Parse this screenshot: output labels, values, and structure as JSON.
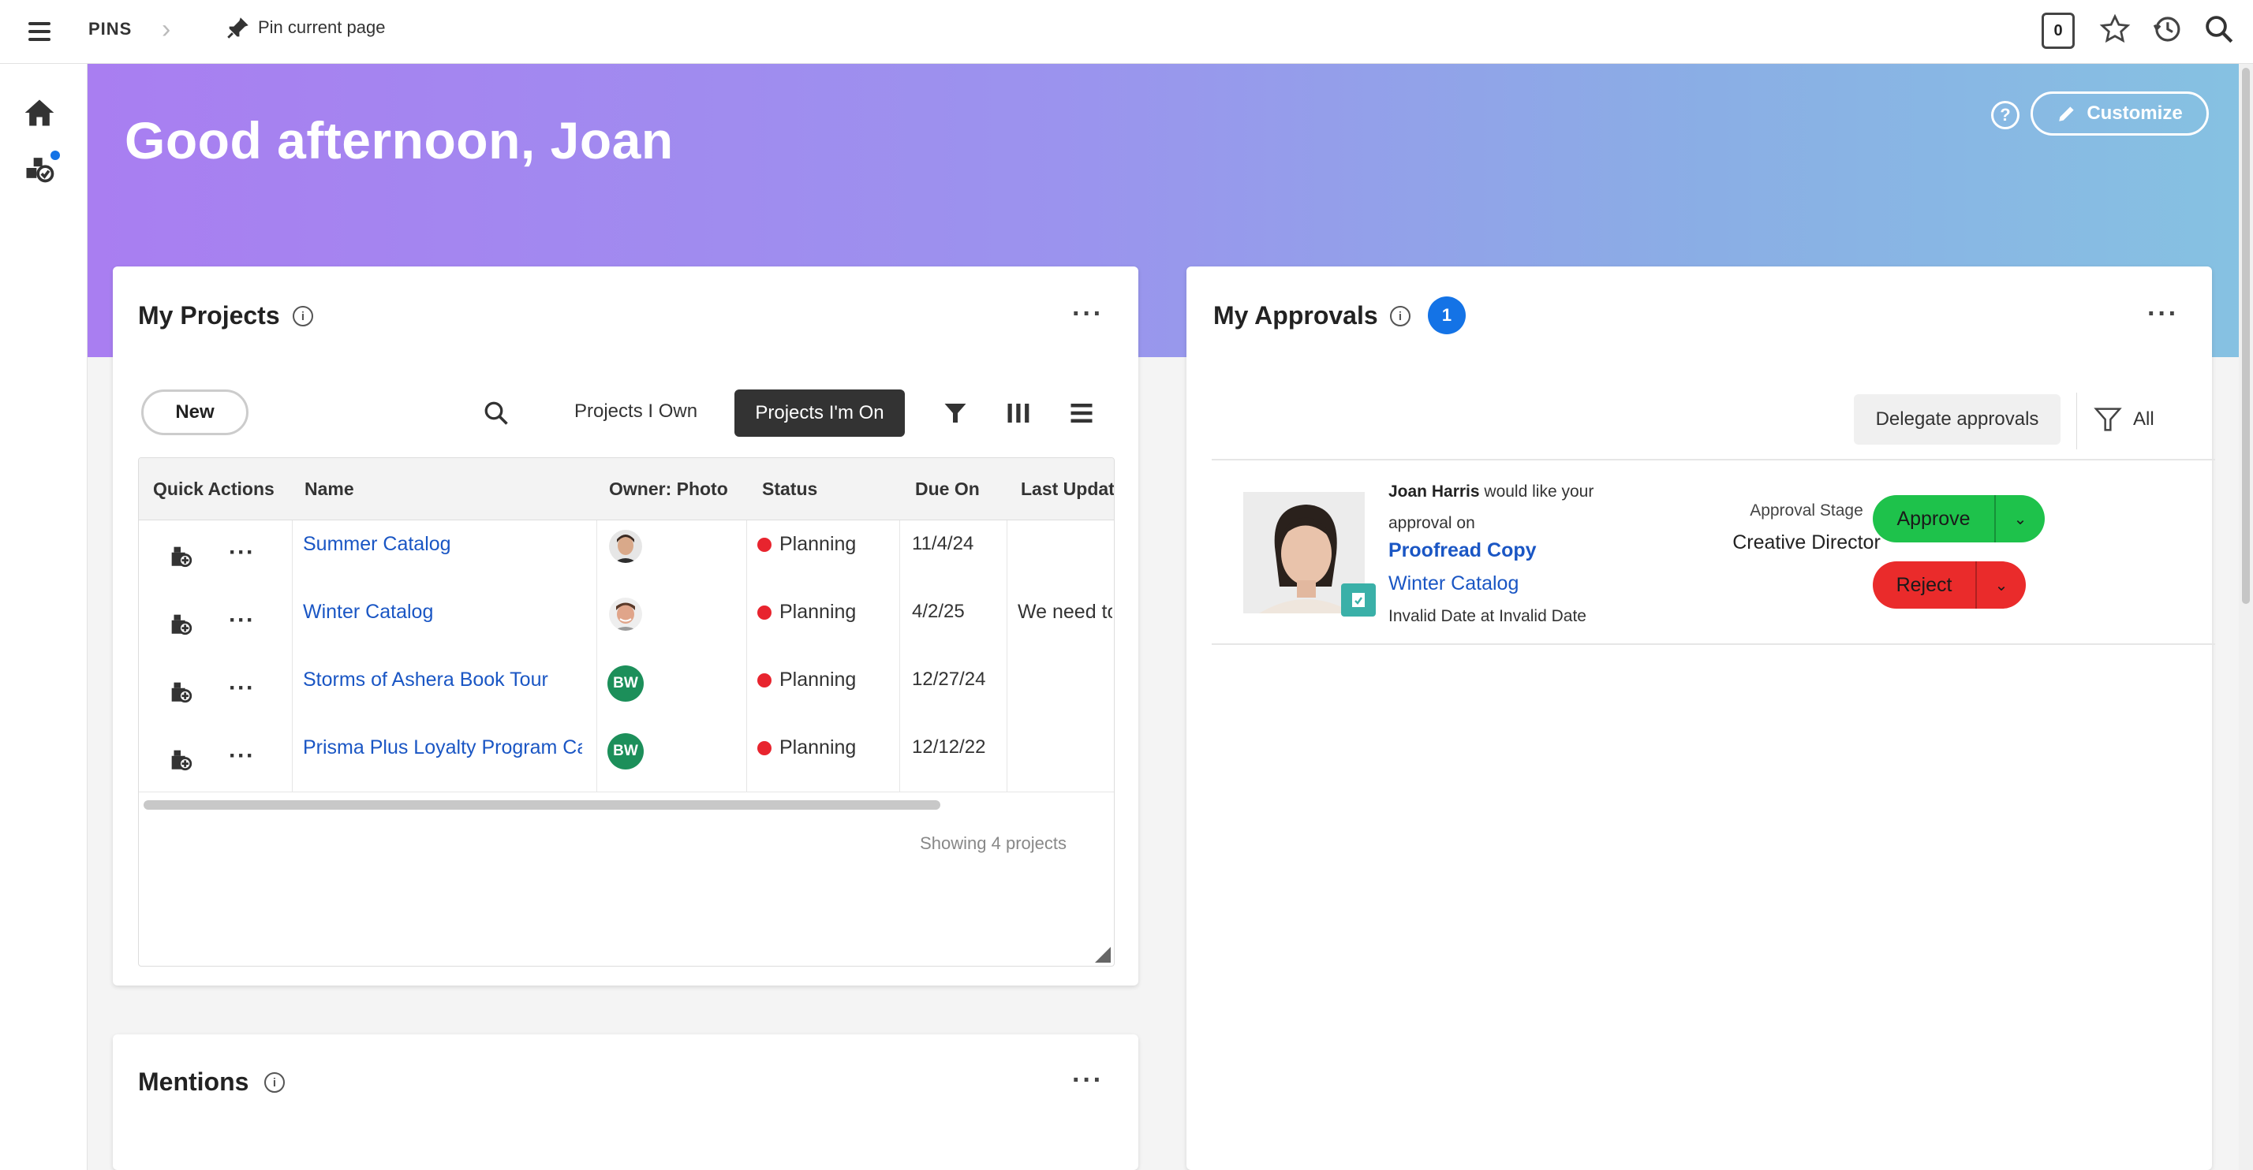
{
  "topbar": {
    "section_label": "PINS",
    "pin_action_label": "Pin current page",
    "counter_value": "0"
  },
  "hero": {
    "greeting": "Good afternoon, Joan",
    "help_symbol": "?",
    "customize_label": "Customize"
  },
  "projects_card": {
    "title": "My Projects",
    "new_button": "New",
    "tab_own": "Projects I Own",
    "tab_on": "Projects I'm On",
    "columns": [
      "Quick Actions",
      "Name",
      "Owner: Photo",
      "Status",
      "Due On",
      "Last Updat"
    ],
    "rows": [
      {
        "name": "Summer Catalog",
        "owner_type": "photo",
        "owner_initials": "",
        "status": "Planning",
        "due": "11/4/24",
        "last_update": ""
      },
      {
        "name": "Winter Catalog",
        "owner_type": "photo",
        "owner_initials": "",
        "status": "Planning",
        "due": "4/2/25",
        "last_update": "We need to"
      },
      {
        "name": "Storms of Ashera Book Tour",
        "owner_type": "initials",
        "owner_initials": "BW",
        "status": "Planning",
        "due": "12/27/24",
        "last_update": ""
      },
      {
        "name": "Prisma Plus Loyalty Program Car",
        "owner_type": "initials",
        "owner_initials": "BW",
        "status": "Planning",
        "due": "12/12/22",
        "last_update": ""
      }
    ],
    "footer": "Showing 4 projects"
  },
  "approvals_card": {
    "title": "My Approvals",
    "count": "1",
    "delegate_button": "Delegate approvals",
    "filter_label": "All",
    "item": {
      "requester": "Joan Harris",
      "request_text": "would like your approval on",
      "title": "Proofread Copy",
      "project": "Winter Catalog",
      "date_text": "Invalid Date at Invalid Date",
      "stage_label": "Approval Stage",
      "stage_value": "Creative Director",
      "approve_label": "Approve",
      "reject_label": "Reject"
    }
  },
  "mentions_card": {
    "title": "Mentions"
  },
  "colors": {
    "accent_blue": "#1473e6",
    "approve_green": "#1ec24b",
    "reject_red": "#ea2b2b",
    "status_red": "#e8242e",
    "link_blue": "#1a56c4",
    "avatar_green": "#1c8f5a"
  },
  "icons": [
    "menu-icon",
    "pin-icon",
    "star-icon",
    "history-icon",
    "search-icon",
    "home-icon",
    "workflow-icon",
    "info-icon",
    "pencil-icon",
    "filter-icon",
    "columns-icon",
    "list-view-icon",
    "add-to-project-icon",
    "more-icon",
    "checklist-icon",
    "chevron-down-icon"
  ]
}
